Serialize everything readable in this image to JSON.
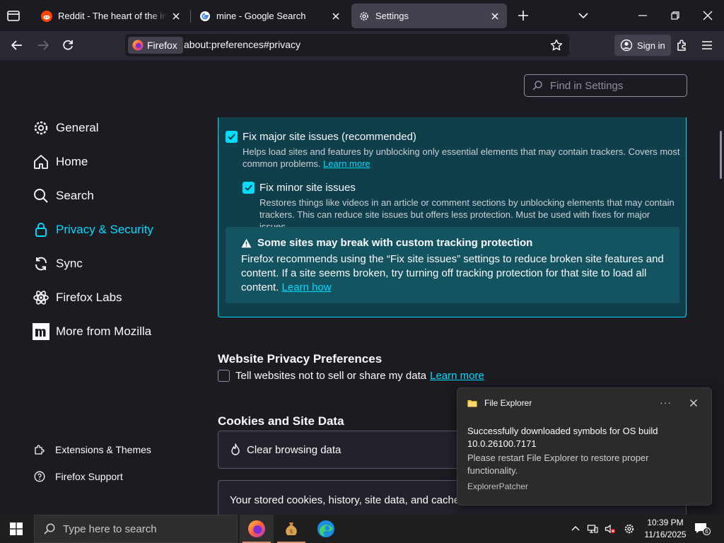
{
  "tabs": [
    {
      "title": "Reddit - The heart of the internet",
      "icon": "reddit-icon",
      "active": false
    },
    {
      "title": "mine - Google Search",
      "icon": "google-icon",
      "active": false
    },
    {
      "title": "Settings",
      "icon": "gear-icon",
      "active": true
    }
  ],
  "navbar": {
    "identity_label": "Firefox",
    "url": "about:preferences#privacy",
    "sign_in": "Sign in"
  },
  "search": {
    "placeholder": "Find in Settings"
  },
  "sidebar": {
    "categories": [
      {
        "label": "General",
        "icon": "gear-icon"
      },
      {
        "label": "Home",
        "icon": "home-icon"
      },
      {
        "label": "Search",
        "icon": "search-icon"
      },
      {
        "label": "Privacy & Security",
        "icon": "lock-icon",
        "selected": true
      },
      {
        "label": "Sync",
        "icon": "sync-icon"
      },
      {
        "label": "Firefox Labs",
        "icon": "labs-icon"
      },
      {
        "label": "More from Mozilla",
        "icon": "mozilla-icon"
      }
    ],
    "footer": [
      {
        "label": "Extensions & Themes",
        "icon": "puzzle-icon"
      },
      {
        "label": "Firefox Support",
        "icon": "help-icon"
      }
    ]
  },
  "etp": {
    "fix_major_label": "Fix major site issues (recommended)",
    "fix_major_desc": "Helps load sites and features by unblocking only essential elements that may contain trackers. Covers most common problems.",
    "fix_major_link": "Learn more",
    "fix_minor_label": "Fix minor site issues",
    "fix_minor_desc": "Restores things like videos in an article or comment sections by unblocking elements that may contain trackers. This can reduce site issues but offers less protection. Must be used with fixes for major issues.",
    "warning_title": "Some sites may break with custom tracking protection",
    "warning_body": "Firefox recommends using the “Fix site issues” settings to reduce broken site features and content. If a site seems broken, try turning off tracking protection for that site to load all content.",
    "warning_link": "Learn how"
  },
  "privacy_prefs": {
    "heading": "Website Privacy Preferences",
    "dns_label": "Tell websites not to sell or share my data",
    "dns_link": "Learn more"
  },
  "cookies": {
    "heading": "Cookies and Site Data",
    "clear_label": "Clear browsing data",
    "stored_text": "Your stored cookies, history, site data, and cache"
  },
  "notification": {
    "app": "File Explorer",
    "more": "···",
    "line1": "Successfully downloaded symbols for OS build 10.0.26100.7171",
    "line2": "Please restart File Explorer to restore proper functionality.",
    "source": "ExplorerPatcher"
  },
  "taskbar": {
    "search_placeholder": "Type here to search",
    "time": "10:39 PM",
    "date": "11/16/2025",
    "notification_count": "6"
  },
  "colors": {
    "accent": "#00ddff",
    "panel": "#0e3f4a",
    "warning": "#135460"
  }
}
